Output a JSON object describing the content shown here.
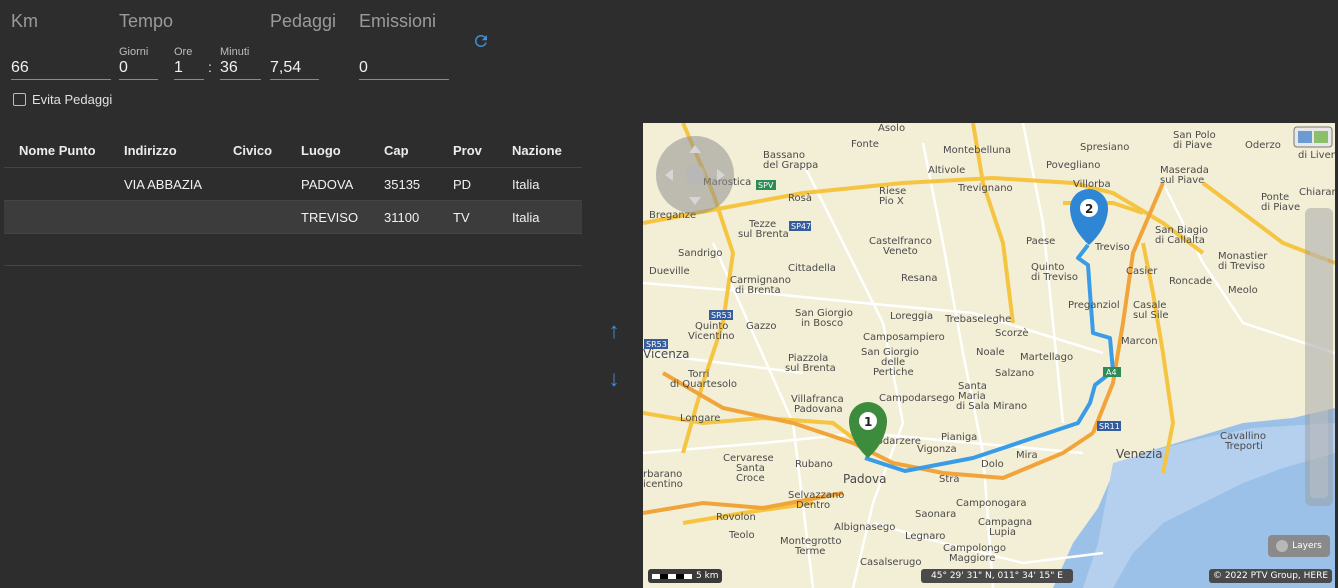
{
  "summary": {
    "km": {
      "label": "Km",
      "value": "66"
    },
    "tempo": {
      "label": "Tempo",
      "giorni_label": "Giorni",
      "giorni": "0",
      "ore_label": "Ore",
      "ore": "1",
      "sep": ":",
      "minuti_label": "Minuti",
      "minuti": "36"
    },
    "pedaggi": {
      "label": "Pedaggi",
      "value": "7,54"
    },
    "emissioni": {
      "label": "Emissioni",
      "value": "0"
    },
    "evita_pedaggi": "Evita Pedaggi"
  },
  "table": {
    "headers": [
      "Nome Punto",
      "Indirizzo",
      "Civico",
      "Luogo",
      "Cap",
      "Prov",
      "Nazione"
    ],
    "rows": [
      [
        "",
        "VIA ABBAZIA",
        "",
        "PADOVA",
        "35135",
        "PD",
        "Italia"
      ],
      [
        "",
        "",
        "",
        "TREVISO",
        "31100",
        "TV",
        "Italia"
      ]
    ]
  },
  "icons": {
    "refresh": "refresh-icon",
    "up": "arrow-up-icon",
    "down": "arrow-down-icon"
  },
  "map": {
    "layers_label": "Layers",
    "scale_label": "5 km",
    "coords": "45° 29' 31\" N, 011° 34' 15\" E",
    "copyright": "© 2022 PTV Group, HERE",
    "markers": [
      "1",
      "2"
    ],
    "places": {
      "asolo": "Asolo",
      "montebelluna": "Montebelluna",
      "spresiano": "Spresiano",
      "san_polo": "San Polo",
      "di_piave": "di Piave",
      "oderzo": "Oderzo",
      "di_livenza": "di Liven",
      "bassano": "Bassano",
      "del_grappa": "del Grappa",
      "fonte": "Fonte",
      "altivole": "Altivole",
      "povegliano": "Povegliano",
      "maserada": "Maserada",
      "sul_piave": "sul Piave",
      "marostica": "Marostica",
      "riese": "Riese",
      "pio_x": "Pio X",
      "trevignano": "Trevignano",
      "villorba": "Villorba",
      "breganze": "Breganze",
      "rosa": "Rosà",
      "ponte": "Ponte",
      "di_piave2": "di Piave",
      "chiarano": "Chiarano",
      "tezze": "Tezze",
      "sul_brenta": "sul Brenta",
      "castelfranco": "Castelfranco",
      "veneto": "Veneto",
      "sandrigo": "Sandrigo",
      "paese": "Paese",
      "treviso": "Treviso",
      "san_biagio": "San Biagio",
      "di_callalta": "di Callalta",
      "dueville": "Dueville",
      "cittadella": "Cittadella",
      "quinto": "Quinto",
      "di_treviso": "di Treviso",
      "casier": "Casier",
      "monastier": "Monastier",
      "di_treviso2": "di Treviso",
      "carmignano": "Carmignano",
      "di_brenta": "di Brenta",
      "resana": "Resana",
      "roncade": "Roncade",
      "meolo": "Meolo",
      "preganziol": "Preganziol",
      "casale": "Casale",
      "sul_sile": "sul Sile",
      "quinto_v": "Quinto",
      "vicentino": "Vicentino",
      "gazzo": "Gazzo",
      "san_giorgio_bosco": "San Giorgio",
      "in_bosco": "in Bosco",
      "loreggia": "Loreggia",
      "trebaseleghe": "Trebaseleghe",
      "scorze": "Scorzè",
      "marcon": "Marcon",
      "vicenza": "Vicenza",
      "camposampiero": "Camposampiero",
      "noale": "Noale",
      "martellago": "Martellago",
      "san_giorgio_pertiche": "San Giorgio",
      "delle": "delle",
      "pertiche": "Pertiche",
      "torri": "Torri",
      "di_quartesolo": "di Quartesolo",
      "piazzola": "Piazzola",
      "sul_brenta2": "sul Brenta",
      "salzano": "Salzano",
      "santa_maria": "Santa",
      "maria": "Maria",
      "di_sala": "di Sala",
      "campodarsego": "Campodarsego",
      "villafranca": "Villafranca",
      "padovana": "Padovana",
      "mirano": "Mirano",
      "longare": "Longare",
      "vigonza": "Vigonza",
      "pianiga": "Pianiga",
      "venezia": "Venezia",
      "cavallino": "Cavallino",
      "treporti": "Treporti",
      "mira": "Mira",
      "dolo": "Dolo",
      "cervarese": "Cervarese",
      "santa_croce": "Santa",
      "croce": "Croce",
      "rubano": "Rubano",
      "padova": "Padova",
      "stra": "Stra",
      "arbarano": "rbarano",
      "icentino": "icentino",
      "camponogara": "Camponogara",
      "selvazzano": "Selvazzano",
      "dentro": "Dentro",
      "saonara": "Saonara",
      "rovolon": "Rovolon",
      "campagna": "Campagna",
      "lupia": "Lupia",
      "albignasego": "Albignasego",
      "teolo": "Teolo",
      "legnaro": "Legnaro",
      "campolongo": "Campolongo",
      "maggiore": "Maggiore",
      "montegrotto": "Montegrotto",
      "terme": "Terme",
      "casalserugo": "Casalserugo",
      "vigodarzere": "Vigodarzere",
      "spv": "SPV",
      "sp47": "SP47",
      "sr53": "SR53",
      "sr53b": "SR53",
      "sr11": "SR11",
      "a4": "A4"
    }
  }
}
